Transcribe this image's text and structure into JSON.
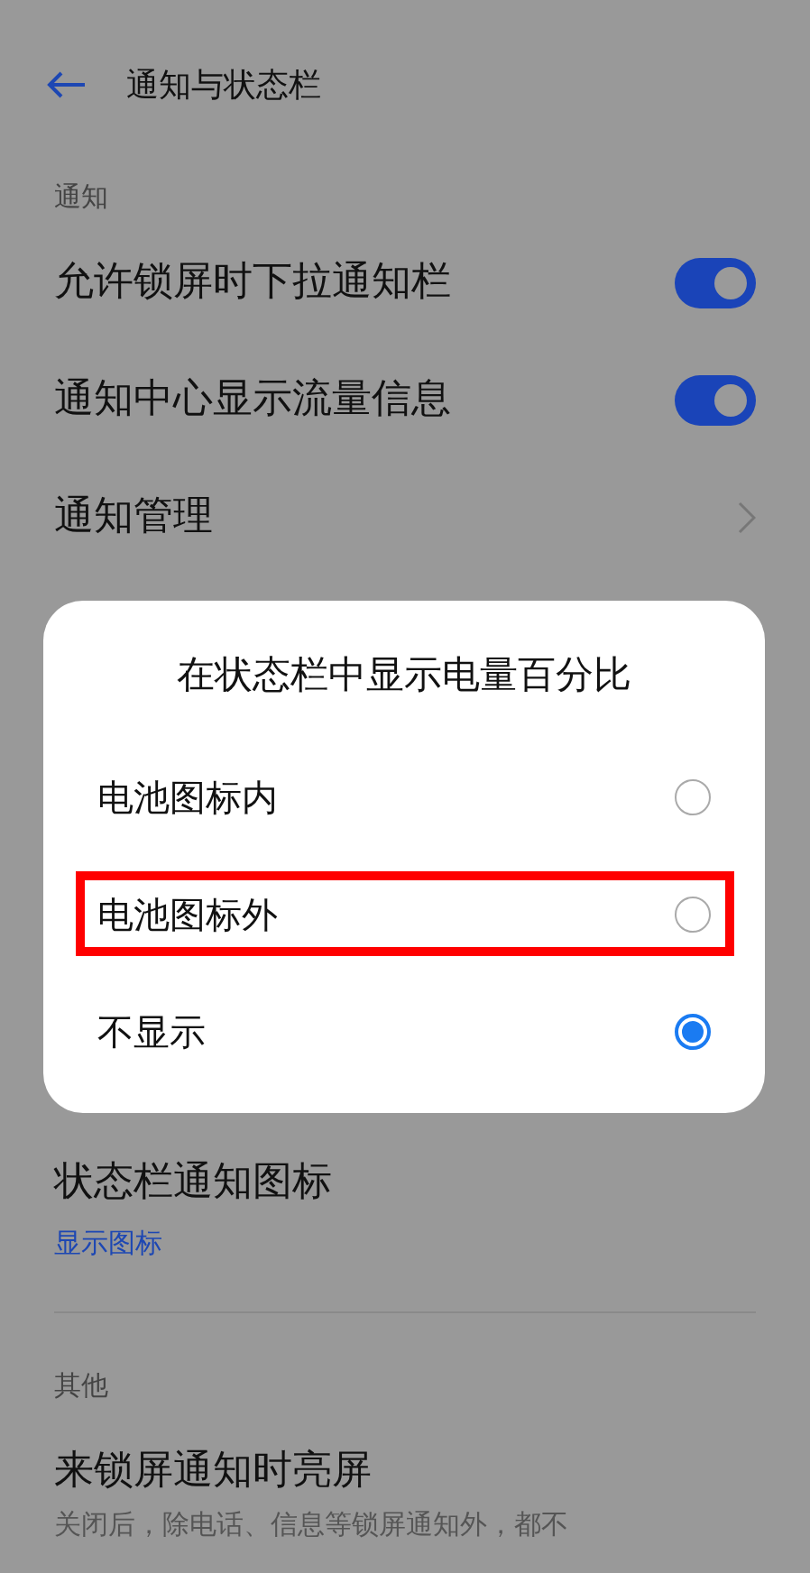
{
  "header": {
    "title": "通知与状态栏"
  },
  "sections": [
    {
      "label": "通知",
      "items": [
        {
          "kind": "toggle",
          "title": "允许锁屏时下拉通知栏",
          "on": true
        },
        {
          "kind": "toggle",
          "title": "通知中心显示流量信息",
          "on": true
        },
        {
          "kind": "link",
          "title": "通知管理"
        }
      ]
    }
  ],
  "lower_items": [
    {
      "title": "状态栏通知图标",
      "value": "显示图标"
    }
  ],
  "other_section": {
    "label": "其他",
    "items": [
      {
        "title": "来锁屏通知时亮屏",
        "subtitle": "关闭后，除电话、信息等锁屏通知外，都不"
      }
    ]
  },
  "dialog": {
    "title": "在状态栏中显示电量百分比",
    "options": [
      {
        "label": "电池图标内",
        "selected": false,
        "highlighted": false
      },
      {
        "label": "电池图标外",
        "selected": false,
        "highlighted": true
      },
      {
        "label": "不显示",
        "selected": true,
        "highlighted": false
      }
    ]
  }
}
